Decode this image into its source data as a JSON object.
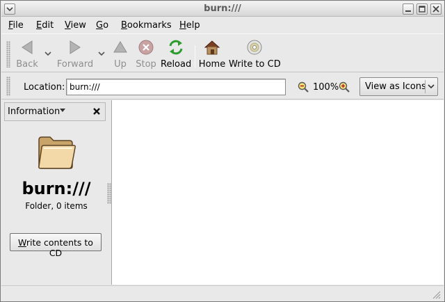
{
  "window": {
    "title": "burn:///"
  },
  "menubar": {
    "items": [
      {
        "label": "File",
        "mnemonic": "F",
        "rest": "ile"
      },
      {
        "label": "Edit",
        "mnemonic": "E",
        "rest": "dit"
      },
      {
        "label": "View",
        "mnemonic": "V",
        "rest": "iew"
      },
      {
        "label": "Go",
        "mnemonic": "G",
        "rest": "o"
      },
      {
        "label": "Bookmarks",
        "mnemonic": "B",
        "rest": "ookmarks"
      },
      {
        "label": "Help",
        "mnemonic": "H",
        "rest": "elp"
      }
    ]
  },
  "toolbar": {
    "back": {
      "label": "Back",
      "icon": "back-arrow-icon",
      "enabled": false
    },
    "forward": {
      "label": "Forward",
      "icon": "forward-arrow-icon",
      "enabled": false
    },
    "up": {
      "label": "Up",
      "icon": "up-arrow-icon",
      "enabled": false
    },
    "stop": {
      "label": "Stop",
      "icon": "stop-icon",
      "enabled": false
    },
    "reload": {
      "label": "Reload",
      "icon": "reload-icon",
      "enabled": true
    },
    "home": {
      "label": "Home",
      "icon": "home-icon",
      "enabled": true
    },
    "write_cd": {
      "label": "Write to CD",
      "icon": "cd-icon",
      "enabled": true
    }
  },
  "location": {
    "label": "Location:",
    "value": "burn:///",
    "zoom_level": "100%",
    "view_mode": "View as Icons"
  },
  "sidepane": {
    "header": "Information",
    "folder_name": "burn:///",
    "folder_info": "Folder, 0 items",
    "write_button_mnemonic": "W",
    "write_button_rest": "rite contents to CD"
  },
  "colors": {
    "disabled_text": "#8e8e8e",
    "content_bg": "#ffffff",
    "chrome_bg": "#e9e9e9"
  }
}
